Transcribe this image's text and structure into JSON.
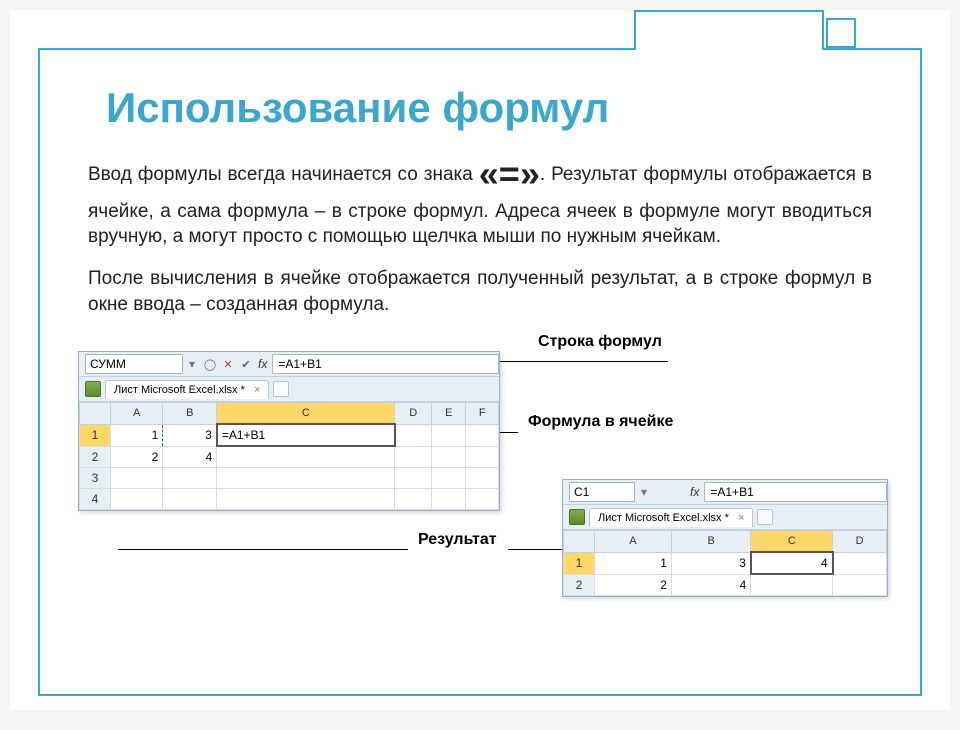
{
  "title": "Использование формул",
  "para1a": "Ввод формулы всегда начинается со знака ",
  "emph1": "«=»",
  "para1b": ". Результат формулы отображается в ячейке, а сама формула – в строке формул. Адреса ячеек в формуле могут вводиться вручную, а могут просто с помощью щелчка мыши по нужным ячейкам.",
  "para2": "После вычисления в ячейке отображается полученный результат, а в строке формул в окне ввода – созданная формула.",
  "labels": {
    "formulaBar": "Строка формул",
    "formulaInCell": "Формула в ячейке",
    "result": "Результат"
  },
  "excelBig": {
    "nameBox": "СУММ",
    "fx": "fx",
    "formula": "=A1+B1",
    "docTab": "Лист Microsoft Excel.xlsx *",
    "close": "×",
    "cols": [
      "",
      "A",
      "B",
      "C",
      "D",
      "E",
      "F"
    ],
    "rows": [
      {
        "n": "1",
        "A": "1",
        "B": "3",
        "C": "=A1+B1"
      },
      {
        "n": "2",
        "A": "2",
        "B": "4",
        "C": ""
      },
      {
        "n": "3",
        "A": "",
        "B": "",
        "C": ""
      },
      {
        "n": "4",
        "A": "",
        "B": "",
        "C": ""
      }
    ]
  },
  "excelSmall": {
    "nameBox": "C1",
    "fx": "fx",
    "formula": "=A1+B1",
    "docTab": "Лист Microsoft Excel.xlsx *",
    "close": "×",
    "cols": [
      "",
      "A",
      "B",
      "C",
      "D"
    ],
    "rows": [
      {
        "n": "1",
        "A": "1",
        "B": "3",
        "C": "4"
      },
      {
        "n": "2",
        "A": "2",
        "B": "4",
        "C": ""
      }
    ]
  }
}
